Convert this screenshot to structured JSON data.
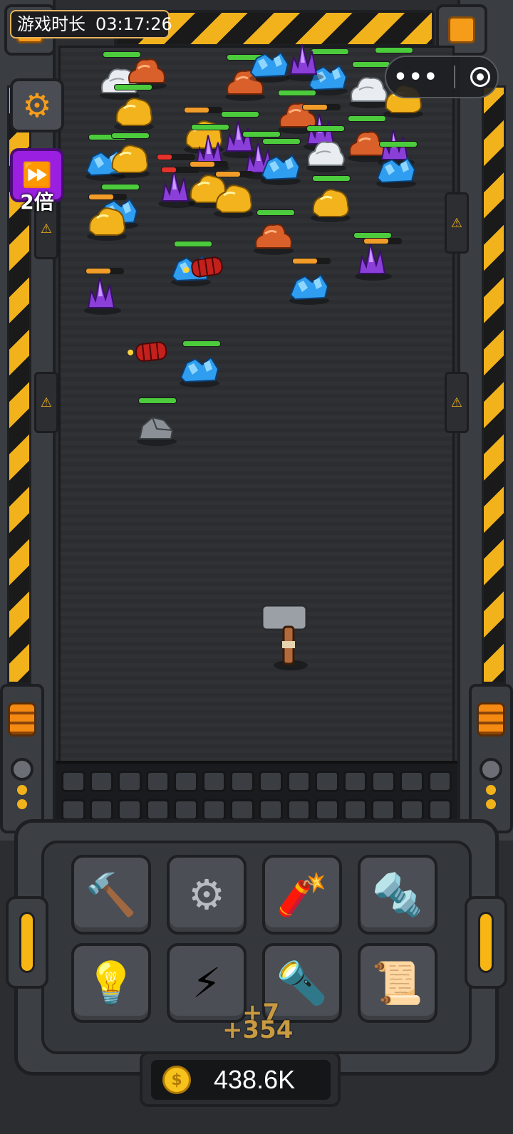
{
  "hud": {
    "timer_label": "游戏时长",
    "timer_value": "03:17:26",
    "speed_label": "2倍",
    "mini_program_more": "•••"
  },
  "tools": [
    {
      "name": "hammer",
      "icon": "hammer-icon",
      "glyph": "🔨"
    },
    {
      "name": "gear",
      "icon": "gear-icon",
      "glyph": "⚙"
    },
    {
      "name": "dynamite",
      "icon": "dynamite-icon",
      "glyph": "🧨"
    },
    {
      "name": "drill",
      "icon": "drill-icon",
      "glyph": "🔩"
    },
    {
      "name": "lightbulb",
      "icon": "lightbulb-icon",
      "glyph": "💡"
    },
    {
      "name": "energy-tube",
      "icon": "energy-tube-icon",
      "glyph": "⚡"
    },
    {
      "name": "laser-cannon",
      "icon": "laser-icon",
      "glyph": "🔦"
    },
    {
      "name": "blueprint",
      "icon": "blueprint-icon",
      "glyph": "📜"
    }
  ],
  "floating_numbers": [
    "+7",
    "+354"
  ],
  "coins": {
    "value": "438.6K",
    "symbol": "$"
  },
  "colors": {
    "hazard_yellow": "#f2b21b",
    "speed_purple": "#9b1fe0",
    "accent_orange": "#f59c1a",
    "hp_green": "#4ccc3c"
  }
}
